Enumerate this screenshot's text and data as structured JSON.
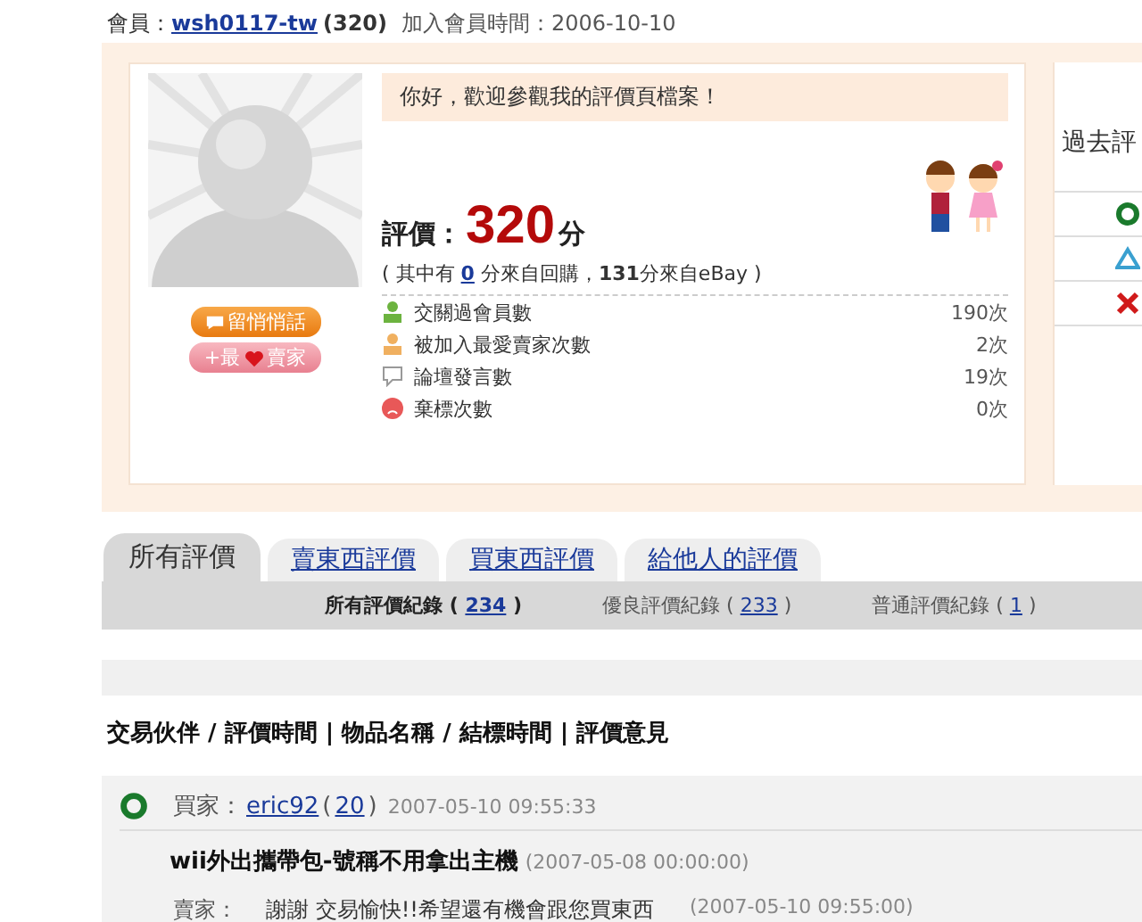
{
  "member": {
    "label": "會員：",
    "name": "wsh0117-tw",
    "score": "(320)",
    "joined": "加入會員時間：2006-10-10"
  },
  "profile": {
    "greeting": "你好，歡迎參觀我的評價頁檔案！",
    "buttons": [
      {
        "kind": "message",
        "label": "留悄悄話"
      },
      {
        "kind": "favorite",
        "prefix": "+最",
        "suffix": "賣家"
      }
    ],
    "rating_label": "評價：",
    "rating": "320",
    "rating_unit": "分",
    "breakdown_pre": "( 其中有 ",
    "breakdown_link": "0",
    "breakdown_post": " 分來自回購，**131**分來自eBay )",
    "stats": [
      {
        "kind": "member",
        "label": "交關過會員數",
        "value": "190次"
      },
      {
        "kind": "favorite",
        "label": "被加入最愛賣家次數",
        "value": "2次"
      },
      {
        "kind": "forum",
        "label": "論壇發言數",
        "value": "19次"
      },
      {
        "kind": "abandon",
        "label": "棄標次數",
        "value": "0次"
      }
    ]
  },
  "history": {
    "title": "過去評",
    "rows": [
      {
        "kind": "good"
      },
      {
        "kind": "neutral"
      },
      {
        "kind": "bad"
      }
    ]
  },
  "tabs": [
    {
      "label": "所有評價",
      "selected": true
    },
    {
      "label": "賣東西評價",
      "selected": false
    },
    {
      "label": "買東西評價",
      "selected": false
    },
    {
      "label": "給他人的評價",
      "selected": false
    }
  ],
  "filters": [
    {
      "label": "所有評價紀錄 (",
      "count": "234",
      "close": ")",
      "selected": true
    },
    {
      "label": "優良評價紀錄 (",
      "count": "233",
      "close": ")",
      "selected": false
    },
    {
      "label": "普通評價紀錄 (",
      "count": "1",
      "close": ")",
      "selected": false
    }
  ],
  "list_heading": "交易伙伴 / 評價時間 | 物品名稱 / 結標時間 | 評價意見",
  "entries": [
    {
      "kind": "good",
      "role": "買家：",
      "partner": "eric92",
      "score_open": "(",
      "partner_score": "20",
      "score_close": ")",
      "time": "2007-05-10 09:55:33",
      "item": "wii外出攜帶包-號稱不用拿出主機",
      "end_time": "(2007-05-08 00:00:00)",
      "reply_role": "賣家：",
      "reply": "謝謝 交易愉快!!希望還有機會跟您買東西",
      "reply_time": "(2007-05-10 09:55:00)"
    }
  ]
}
